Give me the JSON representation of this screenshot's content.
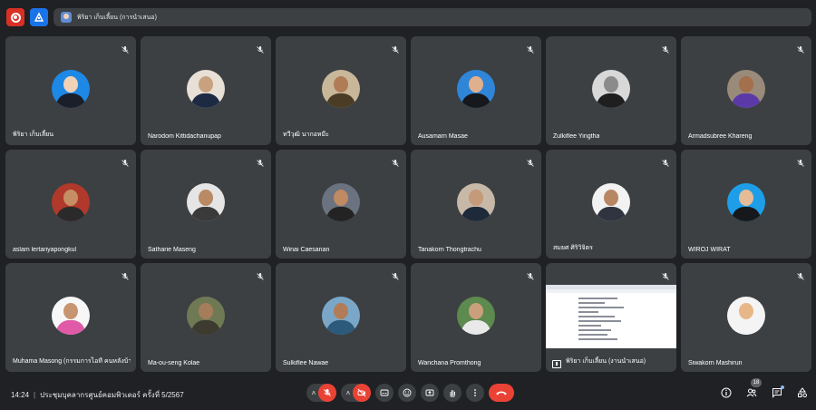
{
  "pinned": {
    "name": "พิริยา เก็บเลี้ยน (การนำเสนอ)"
  },
  "colors": {
    "background": "#202124",
    "tile": "#3c4043",
    "record_red": "#d93025",
    "activity_blue": "#1a73e8",
    "end_call": "#ea4335"
  },
  "participants": [
    {
      "name": "พิริยา เก็บเลี้ยน",
      "avatar_bg": "#1e88e5",
      "skin": "#f1d2b6",
      "clothes": "#1b1f2a",
      "muted": true
    },
    {
      "name": "Narodom Kittidachanupap",
      "avatar_bg": "#e8e0d6",
      "skin": "#c8a27f",
      "clothes": "#1d2a44",
      "muted": true
    },
    {
      "name": "ทวีวุฒิ นากอหมีะ",
      "avatar_bg": "#c9b79a",
      "skin": "#b07c56",
      "clothes": "#4b3d25",
      "muted": true
    },
    {
      "name": "Ausamarn Masae",
      "avatar_bg": "#2f86d9",
      "skin": "#e0b08c",
      "clothes": "#16181c",
      "muted": true
    },
    {
      "name": "Zulkiflee Yingtha",
      "avatar_bg": "#d8d8d8",
      "skin": "#8b8b8b",
      "clothes": "#1f1f1f",
      "muted": true
    },
    {
      "name": "Armadsubree Khareng",
      "avatar_bg": "#9a8a7a",
      "skin": "#a36f4c",
      "clothes": "#5b3aa8",
      "muted": true
    },
    {
      "name": "aslam lertariyapongkul",
      "avatar_bg": "#b0392b",
      "skin": "#c58e65",
      "clothes": "#2a2a2a",
      "muted": true
    },
    {
      "name": "Satharie Maseng",
      "avatar_bg": "#e5e5e5",
      "skin": "#b98a63",
      "clothes": "#3a3a3a",
      "muted": true
    },
    {
      "name": "Winai Caesanan",
      "avatar_bg": "#6b7280",
      "skin": "#c08a62",
      "clothes": "#232323",
      "muted": true
    },
    {
      "name": "Tanakorn Thongtrachu",
      "avatar_bg": "#c7b8a8",
      "skin": "#c49a79",
      "clothes": "#1e2a3a",
      "muted": true
    },
    {
      "name": "สมยศ ศิริวิจิตร",
      "avatar_bg": "#f2f2f2",
      "skin": "#b88663",
      "clothes": "#2f3440",
      "muted": true
    },
    {
      "name": "WIROJ WIRAT",
      "avatar_bg": "#1e9ee8",
      "skin": "#e4bc98",
      "clothes": "#16181c",
      "muted": true
    },
    {
      "name": "Muhama Masong (กรรมการไอที คนหลังบ้าน)",
      "avatar_bg": "#f7f7f7",
      "skin": "#c89571",
      "clothes": "#e05aa8",
      "muted": true
    },
    {
      "name": "Ma-ou-seng Kolae",
      "avatar_bg": "#6f7a55",
      "skin": "#a67d5b",
      "clothes": "#3d3a2f",
      "muted": true
    },
    {
      "name": "Sulkiflee Nawae",
      "avatar_bg": "#7aa7c7",
      "skin": "#b27c58",
      "clothes": "#2c5a7a",
      "muted": true
    },
    {
      "name": "Wanchana Promthong",
      "avatar_bg": "#5d8a4e",
      "skin": "#caa07c",
      "clothes": "#e9e9e9",
      "muted": true
    },
    {
      "name": "พิริยา เก็บเลี้ยน (งานนำเสนอ)",
      "presentation": true,
      "muted": true
    },
    {
      "name": "Siwakorn Mashirun",
      "avatar_bg": "#f4f4f4",
      "skin": "#e7b788",
      "clothes": "#f4f4f4",
      "muted": true
    }
  ],
  "bottom": {
    "time": "14:24",
    "meeting_title": "ประชุมบุคลากรศูนย์คอมพิวเตอร์ ครั้งที่ 5/2567",
    "people_count": "18"
  },
  "icons": {
    "record": "record-icon",
    "activities": "activities-icon",
    "mic_off": "mic-off-icon",
    "cam_off": "camera-off-icon",
    "captions": "captions-icon",
    "emoji": "emoji-icon",
    "present": "present-screen-icon",
    "hand": "raise-hand-icon",
    "more": "more-vert-icon",
    "end": "call-end-icon",
    "info": "info-icon",
    "people": "people-icon",
    "chat": "chat-icon",
    "tools": "host-controls-icon"
  }
}
